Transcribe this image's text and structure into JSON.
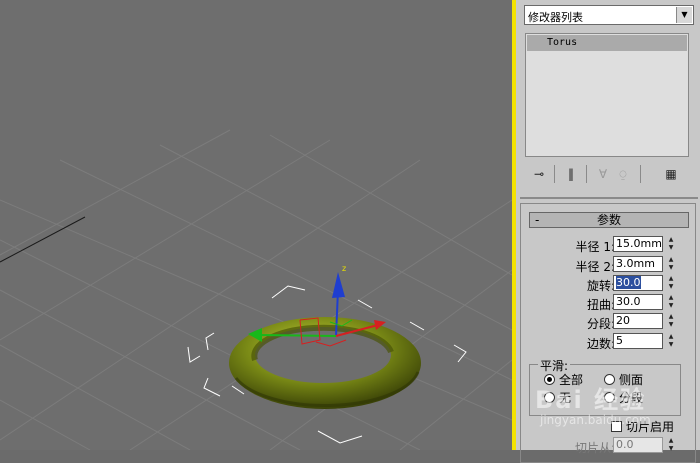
{
  "viewport": {
    "gizmo_axis_label": "z"
  },
  "panel": {
    "modifier_list": {
      "label": "修改器列表"
    },
    "stack": {
      "items": [
        {
          "label": "Torus",
          "selected": true
        }
      ]
    },
    "toolbar": {
      "buttons": [
        {
          "name": "pin-stack-icon",
          "glyph": "⊸"
        },
        {
          "name": "show-end-result-icon",
          "glyph": "‖"
        },
        {
          "name": "make-unique-icon",
          "glyph": "∀"
        },
        {
          "name": "remove-modifier-icon",
          "glyph": "⍜"
        },
        {
          "name": "configure-modifier-sets-icon",
          "glyph": "▦"
        }
      ]
    },
    "rollout": {
      "collapse_glyph": "-",
      "title": "参数",
      "params": [
        {
          "label": "半径 1:",
          "value": "15.0mm",
          "selected": false
        },
        {
          "label": "半径 2:",
          "value": "3.0mm",
          "selected": false
        },
        {
          "label": "旋转:",
          "value": "30.0",
          "selected": true
        },
        {
          "label": "扭曲:",
          "value": "30.0",
          "selected": false
        },
        {
          "label": "分段:",
          "value": "20",
          "selected": false
        },
        {
          "label": "边数:",
          "value": "5",
          "selected": false
        }
      ],
      "smoothing": {
        "title": "平滑:",
        "options": [
          {
            "label": "全部",
            "checked": true
          },
          {
            "label": "侧面",
            "checked": false
          },
          {
            "label": "无",
            "checked": false
          },
          {
            "label": "分段",
            "checked": false
          }
        ]
      },
      "slice_on": {
        "label": "切片启用",
        "checked": false
      },
      "slice_from": {
        "label": "切片从:",
        "value": "0.0"
      }
    }
  },
  "watermark": {
    "text": "Bai 经验",
    "url": "jingyan.baidu.com"
  },
  "colors": {
    "viewport_bg": "#6e6e6e",
    "active_viewport_border": "#f4e200",
    "torus": "#7a8a16",
    "panel_bg": "#c8c8c8",
    "selection": "#2c4f9e"
  }
}
